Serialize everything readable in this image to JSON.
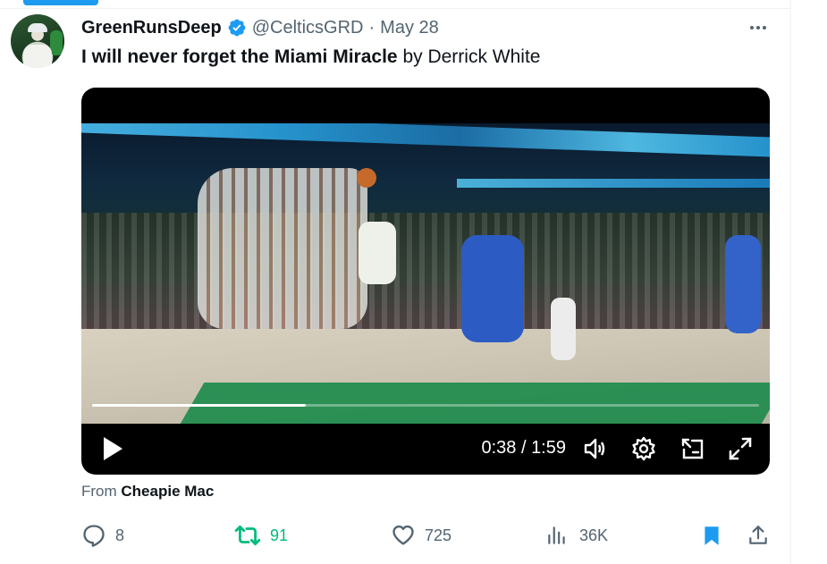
{
  "tweet": {
    "display_name": "GreenRunsDeep",
    "handle": "@CelticsGRD",
    "separator": "·",
    "date": "May 28",
    "text_bold": "I will never forget the Miami Miracle",
    "text_rest": " by Derrick White",
    "verified_color": "#1d9bf0"
  },
  "video": {
    "current_time": "0:38",
    "total_time": "1:59",
    "time_separator": " / ",
    "progress_fraction": 0.32
  },
  "source": {
    "prefix": "From ",
    "name": "Cheapie Mac"
  },
  "actions": {
    "replies": "8",
    "reposts": "91",
    "likes": "725",
    "views": "36K",
    "repost_color": "#00ba7c",
    "bookmark_color": "#1d9bf0"
  },
  "icons": {
    "more": "more-icon",
    "verified": "verified-badge-icon",
    "play": "play-icon",
    "volume": "volume-icon",
    "settings": "gear-icon",
    "pip": "picture-in-picture-icon",
    "fullscreen": "fullscreen-icon",
    "reply": "reply-icon",
    "repost": "repost-icon",
    "like": "heart-icon",
    "views": "views-icon",
    "bookmark": "bookmark-icon",
    "share": "share-icon"
  }
}
